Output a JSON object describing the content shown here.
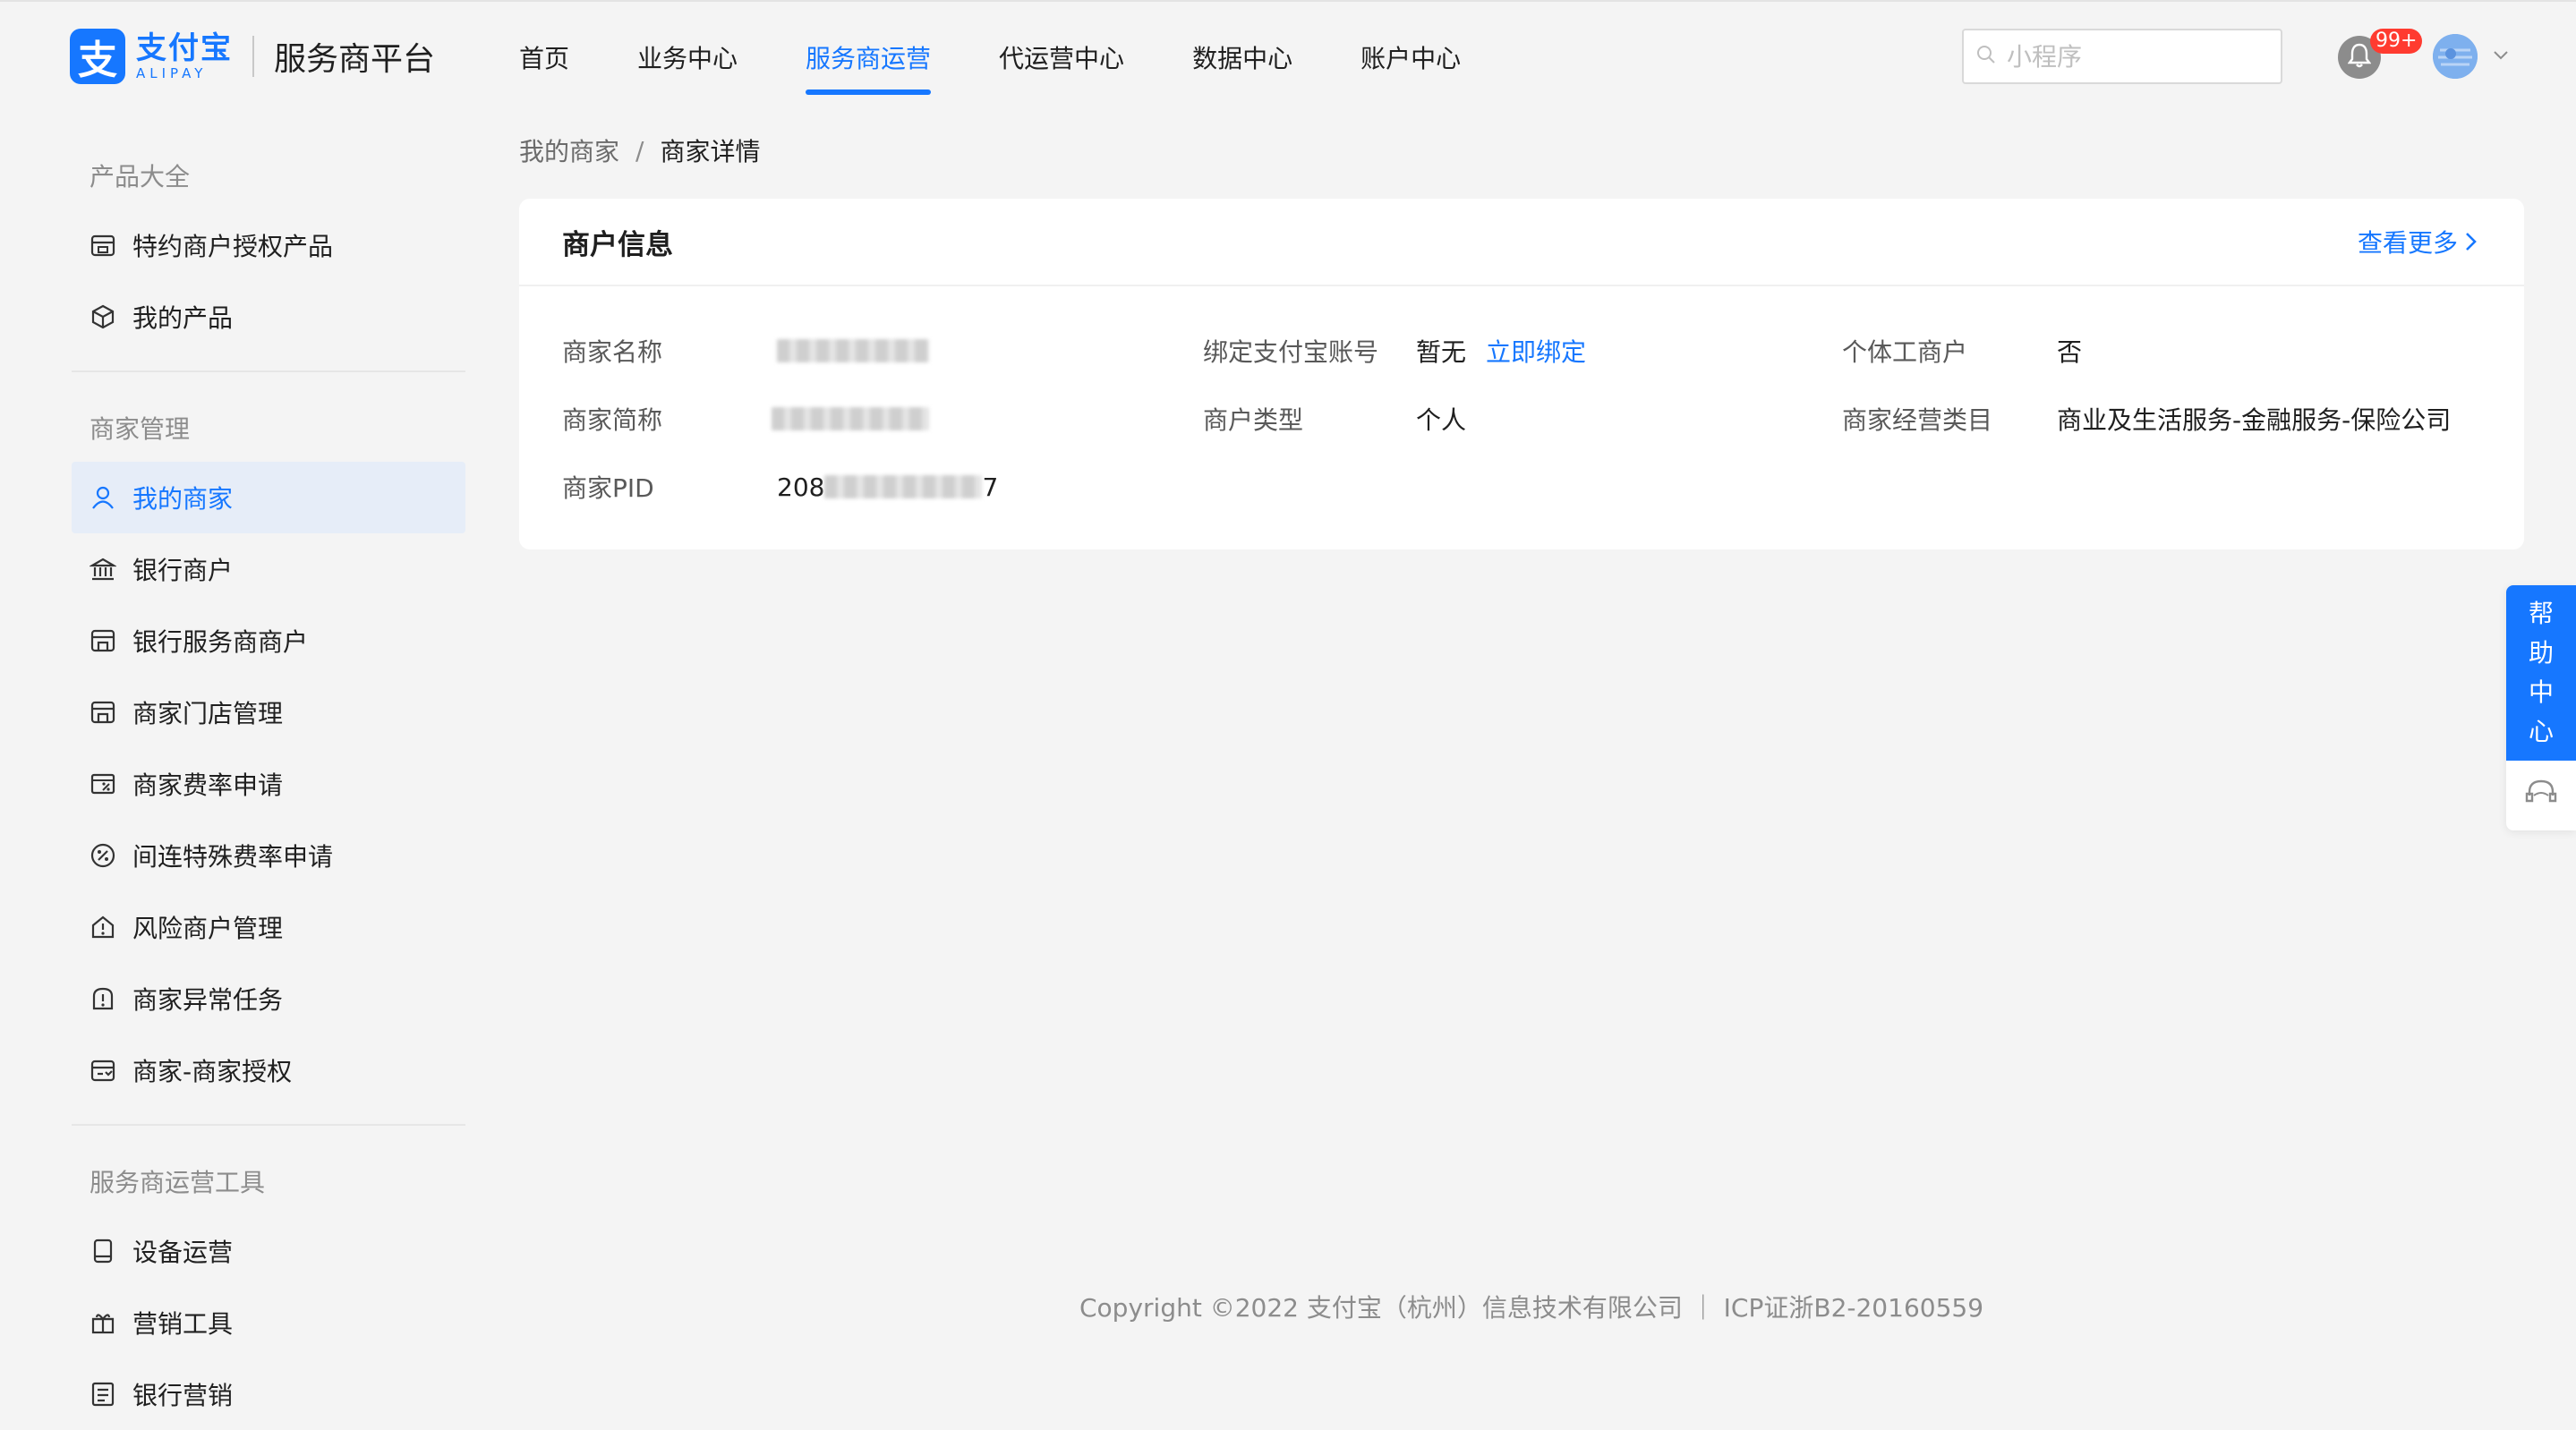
{
  "header": {
    "logo_mark": "支",
    "logo_cn": "支付宝",
    "logo_en": "ALIPAY",
    "platform": "服务商平台",
    "nav": [
      {
        "label": "首页",
        "active": false
      },
      {
        "label": "业务中心",
        "active": false
      },
      {
        "label": "服务商运营",
        "active": true
      },
      {
        "label": "代运营中心",
        "active": false
      },
      {
        "label": "数据中心",
        "active": false
      },
      {
        "label": "账户中心",
        "active": false
      }
    ],
    "search_placeholder": "小程序",
    "notification_count": "99+",
    "accent": "#1677ff"
  },
  "sidebar": {
    "groups": [
      {
        "title": "产品大全",
        "items": [
          {
            "label": "特约商户授权产品",
            "icon": "shop-icon"
          },
          {
            "label": "我的产品",
            "icon": "cube-icon"
          }
        ]
      },
      {
        "title": "商家管理",
        "items": [
          {
            "label": "我的商家",
            "icon": "user-icon",
            "active": true
          },
          {
            "label": "银行商户",
            "icon": "bank-icon"
          },
          {
            "label": "银行服务商商户",
            "icon": "store-icon"
          },
          {
            "label": "商家门店管理",
            "icon": "store-icon"
          },
          {
            "label": "商家费率申请",
            "icon": "rate-icon"
          },
          {
            "label": "间连特殊费率申请",
            "icon": "percent-icon"
          },
          {
            "label": "风险商户管理",
            "icon": "risk-home-icon"
          },
          {
            "label": "商家异常任务",
            "icon": "alert-icon"
          },
          {
            "label": "商家-商家授权",
            "icon": "authorize-icon"
          }
        ]
      },
      {
        "title": "服务商运营工具",
        "items": [
          {
            "label": "设备运营",
            "icon": "device-icon"
          },
          {
            "label": "营销工具",
            "icon": "gift-icon"
          },
          {
            "label": "银行营销",
            "icon": "list-icon"
          }
        ]
      }
    ]
  },
  "breadcrumb": {
    "parent": "我的商家",
    "separator": "/",
    "current": "商家详情"
  },
  "card": {
    "title": "商户信息",
    "more": "查看更多",
    "fields": {
      "name_label": "商家名称",
      "short_label": "商家简称",
      "pid_label": "商家PID",
      "pid_prefix": "208",
      "pid_suffix": "7",
      "bind_label": "绑定支付宝账号",
      "bind_value": "暂无",
      "bind_link": "立即绑定",
      "type_label": "商户类型",
      "type_value": "个人",
      "individual_label": "个体工商户",
      "individual_value": "否",
      "category_label": "商家经营类目",
      "category_value": "商业及生活服务-金融服务-保险公司"
    }
  },
  "footer": "Copyright ©2022 支付宝（杭州）信息技术有限公司 ｜ ICP证浙B2-20160559",
  "help": {
    "chars": [
      "帮",
      "助",
      "中",
      "心"
    ]
  }
}
